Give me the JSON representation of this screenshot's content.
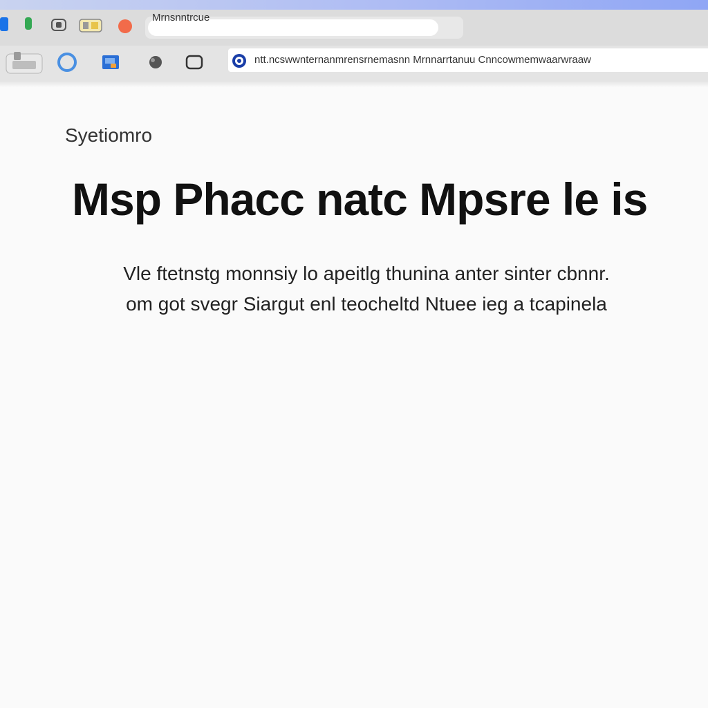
{
  "browser": {
    "tab_title": "Mrnsnntrcue",
    "address": "ntt.ncswwnternanmrensrnemasnn Mrnnarrtanuu Cnncowmemwaarwraaw",
    "colors": {
      "accent_strip": "#8fa6f5",
      "tab_bar": "#dcdcdc",
      "toolbar": "#e4e4e4",
      "active_tab": "#ffffff",
      "page_background": "#fafafa"
    },
    "tab_buttons": [
      {
        "name": "blue-square-icon",
        "color": "#1a73e8"
      },
      {
        "name": "green-square-icon",
        "color": "#34a853"
      },
      {
        "name": "back-icon",
        "color": "#555555"
      },
      {
        "name": "window-icon",
        "color": "#e8c44a"
      },
      {
        "name": "record-icon",
        "color": "#f26b4a"
      }
    ],
    "toolbar_buttons": [
      {
        "name": "print-icon"
      },
      {
        "name": "account-icon",
        "color": "#4a90e2"
      },
      {
        "name": "bookmark-icon",
        "color": "#2a6fd6"
      },
      {
        "name": "extension-icon"
      },
      {
        "name": "screen-icon"
      }
    ],
    "site_icon": {
      "name": "site-icon",
      "color": "#1a3ea8"
    }
  },
  "page": {
    "kicker": "Syetiomro",
    "headline": "Msp Phacc natc Mpsre le is",
    "paragraph_line_1": "Vle ftetnstg monnsiy lo apeitlg thunina anter sinter cbnnr.",
    "paragraph_line_2": "om got svegr Siargut enl teocheltd Ntuee ieg a tcapinela"
  }
}
